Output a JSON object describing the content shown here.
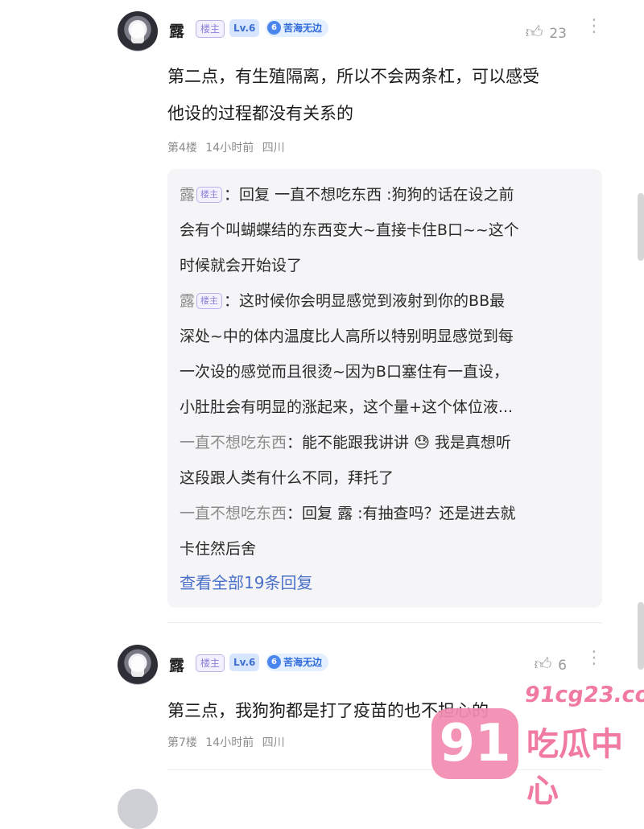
{
  "comments": [
    {
      "author": "露",
      "owner_badge": "楼主",
      "level": "Lv.6",
      "medal_num": "6",
      "medal_name": "苦海无边",
      "likes": "23",
      "text_lines": [
        "第二点，有生殖隔离，所以不会两条杠，可以感受",
        "他设的过程都没有关系的"
      ],
      "floor": "第4楼",
      "time": "14小时前",
      "location": "四川"
    },
    {
      "author": "露",
      "owner_badge": "楼主",
      "level": "Lv.6",
      "medal_num": "6",
      "medal_name": "苦海无边",
      "likes": "6",
      "text_lines": [
        "第三点，我狗狗都是打了疫苗的也不担心的"
      ],
      "floor": "第7楼",
      "time": "14小时前",
      "location": "四川"
    }
  ],
  "replies": [
    {
      "author": "露",
      "owner_badge": "楼主",
      "sep": "：",
      "lines": [
        "回复 一直不想吃东西 :狗狗的话在设之前",
        "会有个叫蝴蝶结的东西变大~直接卡住B口~~这个",
        "时候就会开始设了"
      ]
    },
    {
      "author": "露",
      "owner_badge": "楼主",
      "sep": "：",
      "lines": [
        "这时候你会明显感觉到液射到你的BB最",
        "深处~中的体内温度比人高所以特别明显感觉到每",
        "一次设的感觉而且很烫~因为B口塞住有一直设，",
        "小肚肚会有明显的涨起来，这个量+这个体位液..."
      ]
    },
    {
      "author": "一直不想吃东西",
      "sep": "：",
      "lines": [
        "能不能跟我讲讲 😓 我是真想听",
        "这段跟人类有什么不同，拜托了"
      ]
    },
    {
      "author": "一直不想吃东西",
      "sep": "：",
      "lines": [
        "回复 露 :有抽查吗？还是进去就",
        "卡住然后舍"
      ]
    }
  ],
  "view_all_replies": "查看全部19条回复",
  "icons": {
    "like": "thumbs-up-icon",
    "more": "more-vertical-icon"
  },
  "watermark": {
    "url": "91cg23.com",
    "number": "91",
    "text": "吃瓜中心"
  }
}
